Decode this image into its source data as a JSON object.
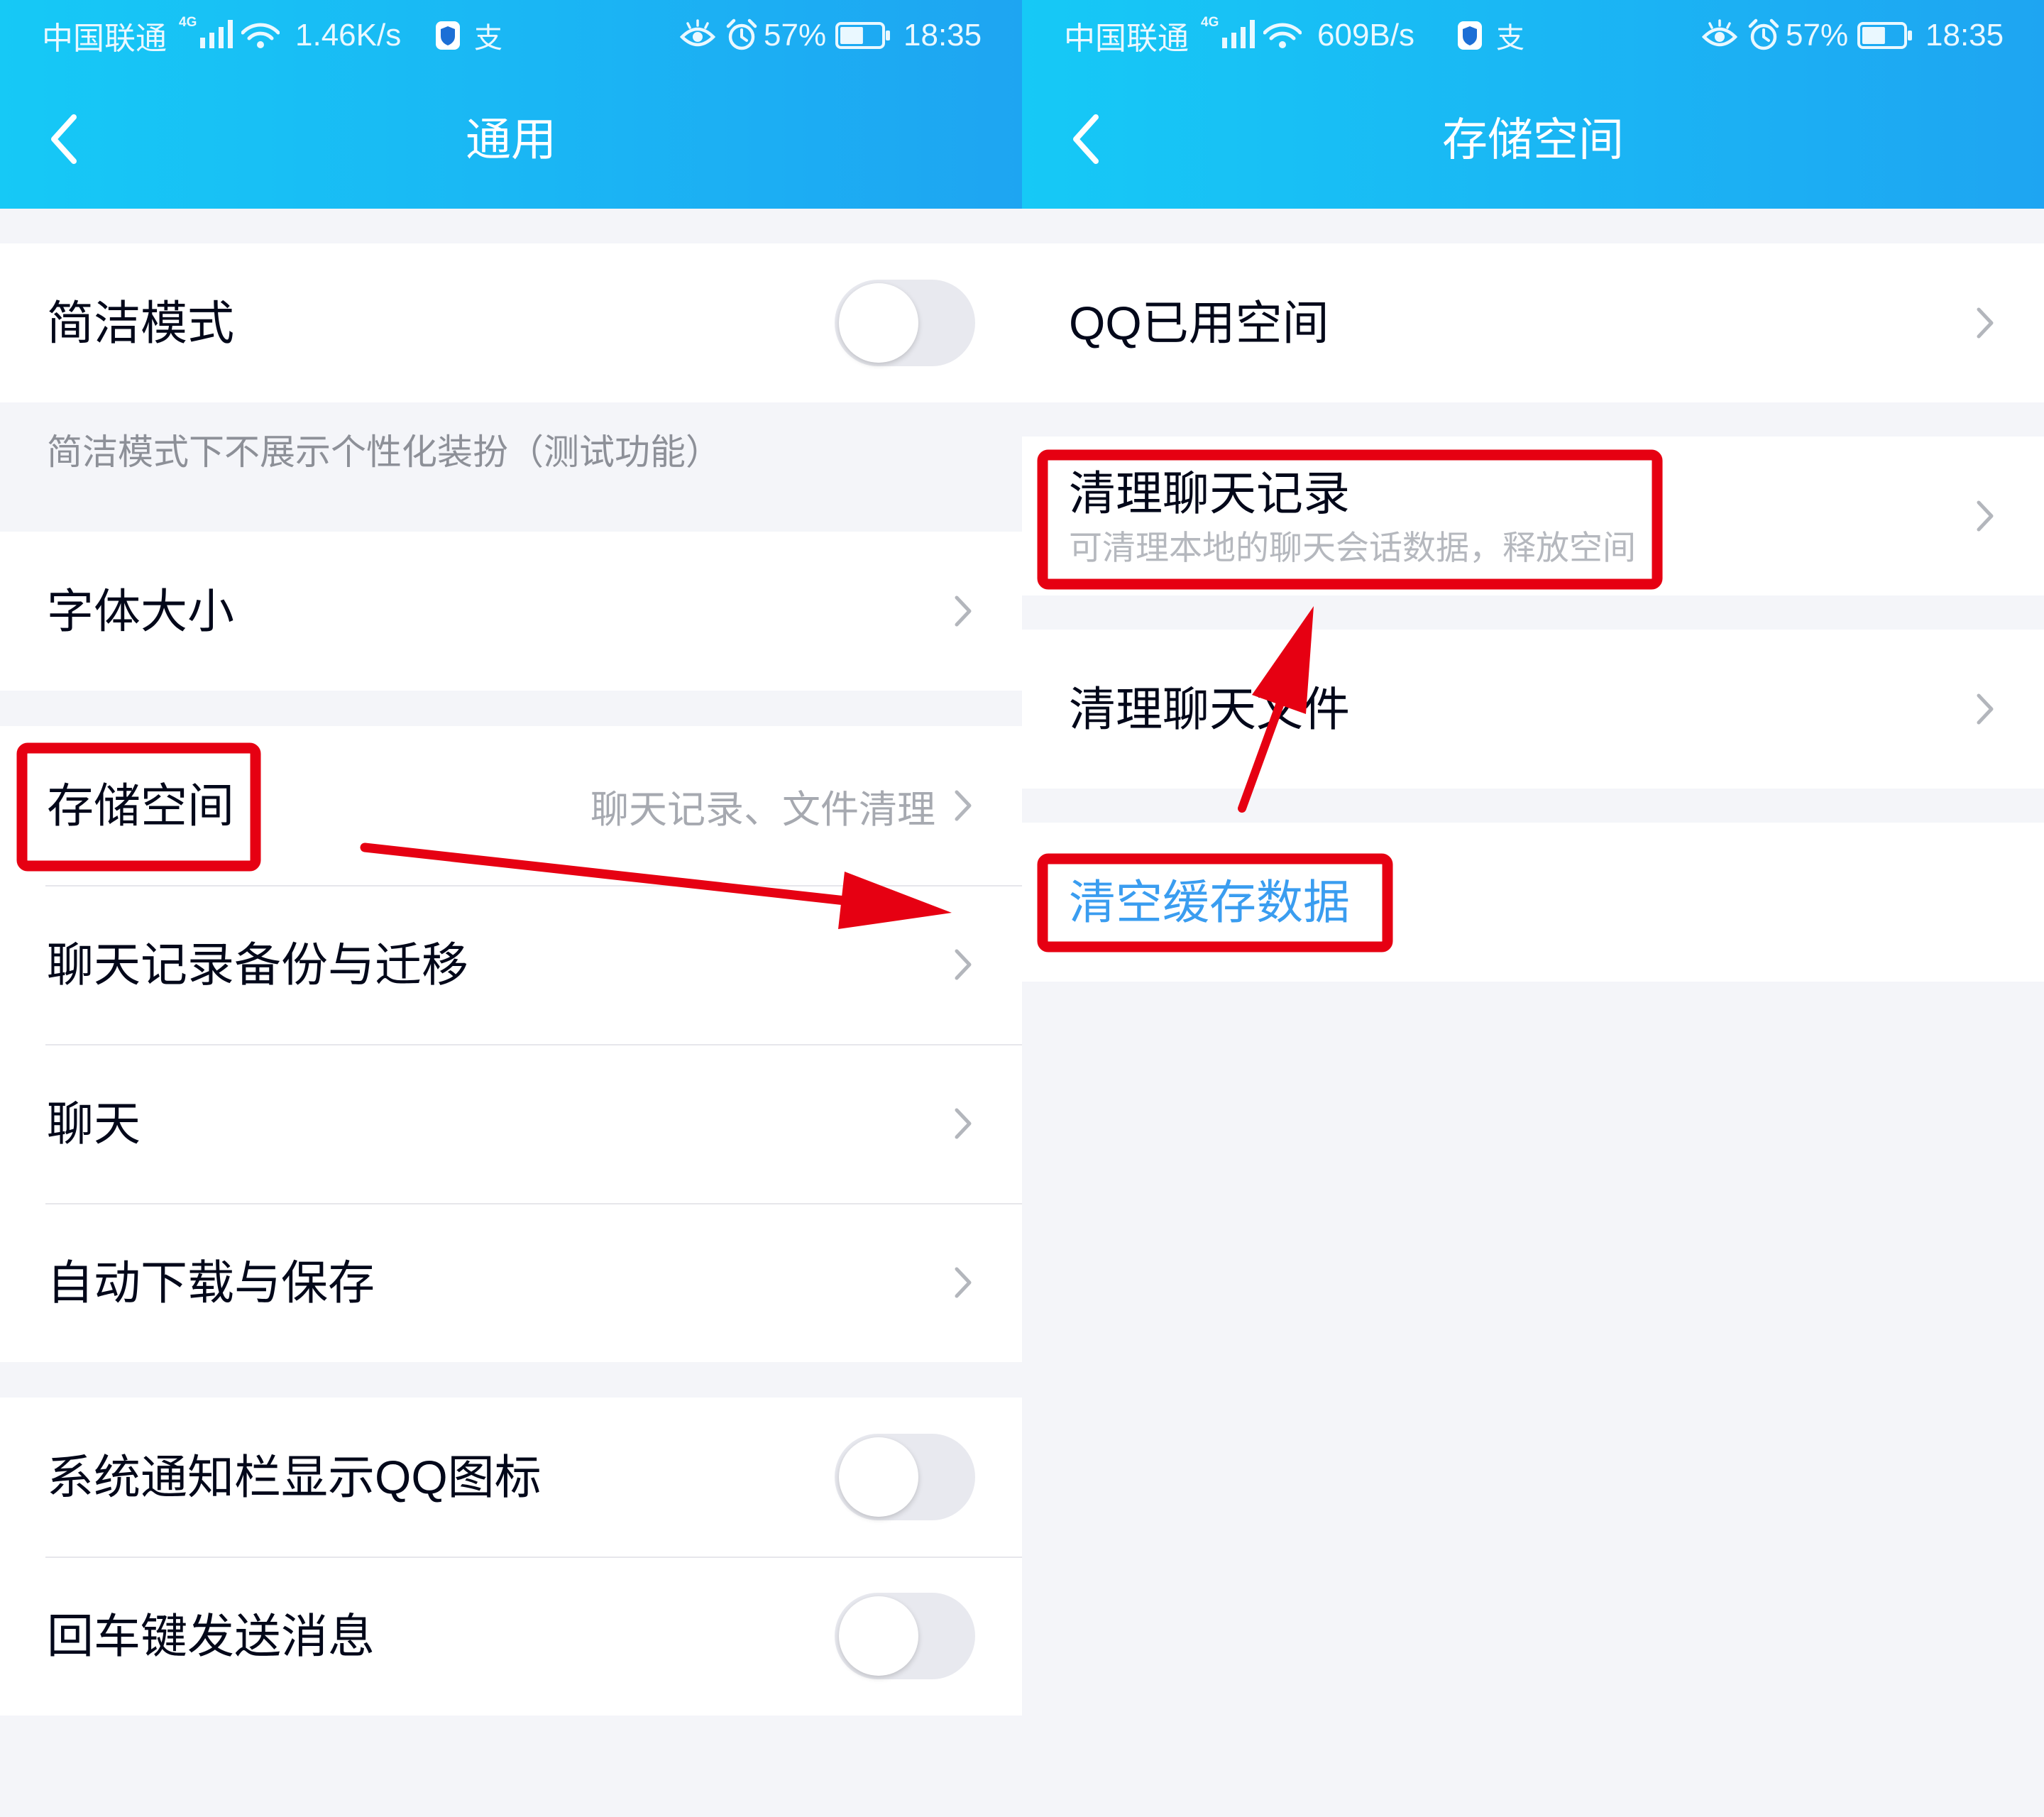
{
  "colors": {
    "header_gradient_start": "#16c9f6",
    "header_gradient_end": "#1ea5f2",
    "page_background": "#f4f5f9",
    "row_background": "#ffffff",
    "primary_text": "#03081a",
    "secondary_text": "#a6a9b0",
    "link_blue": "#3a9df0",
    "annotation_red": "#e60012",
    "toggle_off": "#e8e9ef"
  },
  "left": {
    "status_bar": {
      "carrier": "中国联通",
      "network_type": "4G",
      "net_speed": "1.46K/s",
      "alipay_glyph": "支",
      "battery_percent": "57%",
      "battery_level": 0.57,
      "time": "18:35",
      "icons": [
        "signal-icon",
        "wifi-icon",
        "shield-icon",
        "alipay-icon",
        "eye-comfort-icon",
        "alarm-icon",
        "battery-icon"
      ]
    },
    "header": {
      "title": "通用",
      "back_icon": "chevron-left-icon"
    },
    "concise_mode": {
      "label": "简洁模式",
      "enabled": false,
      "note": "简洁模式下不展示个性化装扮（测试功能）"
    },
    "font_size": {
      "label": "字体大小"
    },
    "storage": {
      "label": "存储空间",
      "detail": "聊天记录、文件清理"
    },
    "more_items": [
      {
        "label": "聊天记录备份与迁移"
      },
      {
        "label": "聊天"
      },
      {
        "label": "自动下载与保存"
      }
    ],
    "switches": [
      {
        "label": "系统通知栏显示QQ图标",
        "enabled": false
      },
      {
        "label": "回车键发送消息",
        "enabled": false
      }
    ]
  },
  "right": {
    "status_bar": {
      "carrier": "中国联通",
      "network_type": "4G",
      "net_speed": "609B/s",
      "alipay_glyph": "支",
      "battery_percent": "57%",
      "battery_level": 0.57,
      "time": "18:35",
      "icons": [
        "signal-icon",
        "wifi-icon",
        "shield-icon",
        "alipay-icon",
        "eye-comfort-icon",
        "alarm-icon",
        "battery-icon"
      ]
    },
    "header": {
      "title": "存储空间",
      "back_icon": "chevron-left-icon"
    },
    "items": [
      {
        "label": "QQ已用空间"
      },
      {
        "label": "清理聊天记录",
        "subtitle": "可清理本地的聊天会话数据，释放空间"
      },
      {
        "label": "清理聊天文件"
      }
    ],
    "clear_cache": {
      "label": "清空缓存数据"
    }
  }
}
